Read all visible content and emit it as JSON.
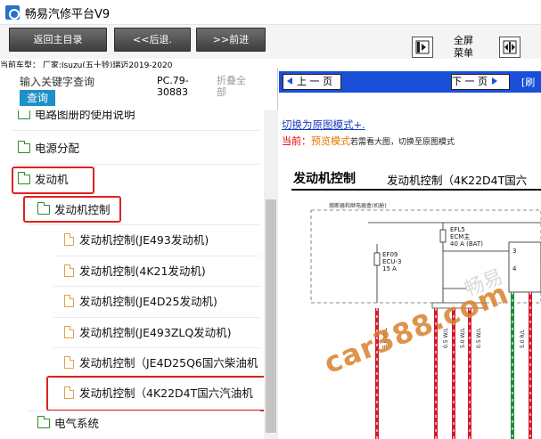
{
  "window": {
    "title": "畅易汽修平台V9",
    "icon": "app-logo-icon"
  },
  "toolbar": {
    "back_label": "返回主目录",
    "prev_label": "<<后退.",
    "next_label": ">>前进",
    "fullscreen_label": "全屏",
    "menu_label": "菜单"
  },
  "car_model": "当前车型： 厂家:Isuzu(五十铃)瑞迈2019-2020",
  "search": {
    "placeholder": "输入关键字查询",
    "button": "查询",
    "code": "PC.79-30883",
    "fold_all": "折叠全部"
  },
  "tree": {
    "items": [
      {
        "label": "电路图册的使用说明",
        "type": "folder"
      },
      {
        "label": "电源分配",
        "type": "folder"
      },
      {
        "label": "发动机",
        "type": "folder",
        "highlighted": true
      },
      {
        "label": "发动机控制",
        "type": "folder",
        "highlighted": true
      },
      {
        "label": "发动机控制(JE493发动机)",
        "type": "doc"
      },
      {
        "label": "发动机控制(4K21发动机)",
        "type": "doc"
      },
      {
        "label": "发动机控制(JE4D25发动机)",
        "type": "doc"
      },
      {
        "label": "发动机控制(JE493ZLQ发动机)",
        "type": "doc"
      },
      {
        "label": "发动机控制（JE4D25Q6国六柴油机",
        "type": "doc"
      },
      {
        "label": "发动机控制（4K22D4T国六汽油机",
        "type": "doc",
        "highlighted": true
      },
      {
        "label": "电气系统",
        "type": "folder"
      }
    ]
  },
  "viewer": {
    "prev_page": "上 一 页",
    "next_page": "下 一 页",
    "refresh": "[刷",
    "orig_link": "切换为原图模式+.",
    "current_key": "当前：",
    "current_mode": "预览模式",
    "current_desc": "若需看大图，切换至原图模式",
    "diagram_title": "发动机控制",
    "diagram_subtitle": "发动机控制（4K22D4T国六",
    "fuse_box_label": "熔断器和继电器盒(机舱)",
    "fuse1": {
      "name": "EFL5",
      "desc": "ECM主",
      "rating": "40 A (BAT)"
    },
    "fuse2": {
      "name": "EF09",
      "desc": "ECU-3",
      "rating": "15 A"
    },
    "wire_labels": [
      "5.0 W/L",
      "0.5 W/L",
      "5.0 W/L",
      "0.5 W/L",
      "5.0 R/L"
    ],
    "pin_labels": [
      "3",
      "4"
    ]
  },
  "watermark": {
    "text": "car388.com",
    "faint": "畅易"
  },
  "colors": {
    "nav_blue": "#1a50d8",
    "highlight_red": "#e02020",
    "search_blue": "#1e8fc8",
    "folder_green": "#2e8b2e",
    "doc_orange": "#e0a24a"
  }
}
